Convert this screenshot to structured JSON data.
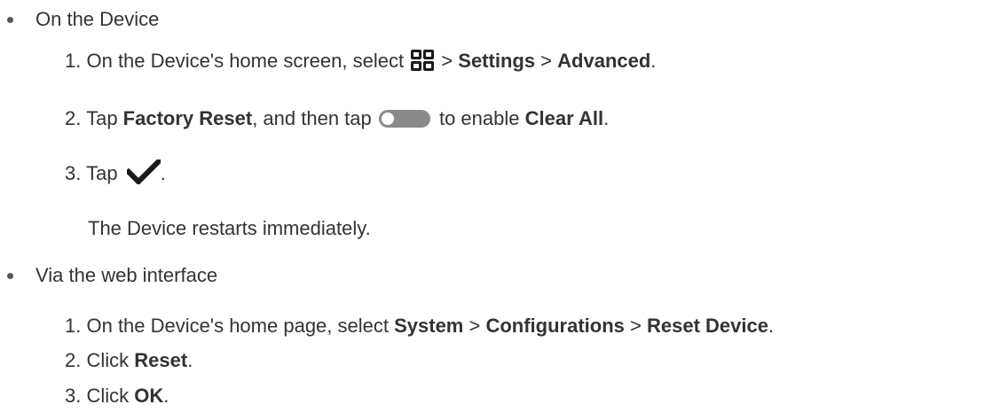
{
  "section_device": {
    "heading": "On the Device",
    "step1": {
      "number": "1.",
      "text_before": "On the Device's home screen, select ",
      "separator_1": " > ",
      "settings": "Settings",
      "separator_2": " > ",
      "advanced": "Advanced",
      "end": "."
    },
    "step2": {
      "number": "2.",
      "tap": "Tap ",
      "factory_reset": "Factory Reset",
      "middle": ", and then tap ",
      "after_toggle": " to enable ",
      "clear_all": "Clear All",
      "end": "."
    },
    "step3": {
      "number": "3.",
      "tap": "Tap ",
      "end": "."
    },
    "result_note": "The Device restarts immediately."
  },
  "section_web": {
    "heading": "Via the web interface",
    "step1": {
      "number": "1.",
      "text_before": "On the Device's home page, select ",
      "system": "System",
      "separator_1": " > ",
      "configurations": "Configurations",
      "separator_2": " > ",
      "reset_device": "Reset Device",
      "end": "."
    },
    "step2": {
      "number": "2.",
      "click": "Click ",
      "reset": "Reset",
      "end": "."
    },
    "step3": {
      "number": "3.",
      "click": "Click ",
      "ok": "OK",
      "end": "."
    }
  },
  "icons": {
    "grid": "apps-grid-icon",
    "toggle": "toggle-off-icon",
    "check": "checkmark-icon"
  },
  "colors": {
    "text": "#333333",
    "icon_dark": "#1a1a1a",
    "toggle_track": "#8a8a8a"
  }
}
